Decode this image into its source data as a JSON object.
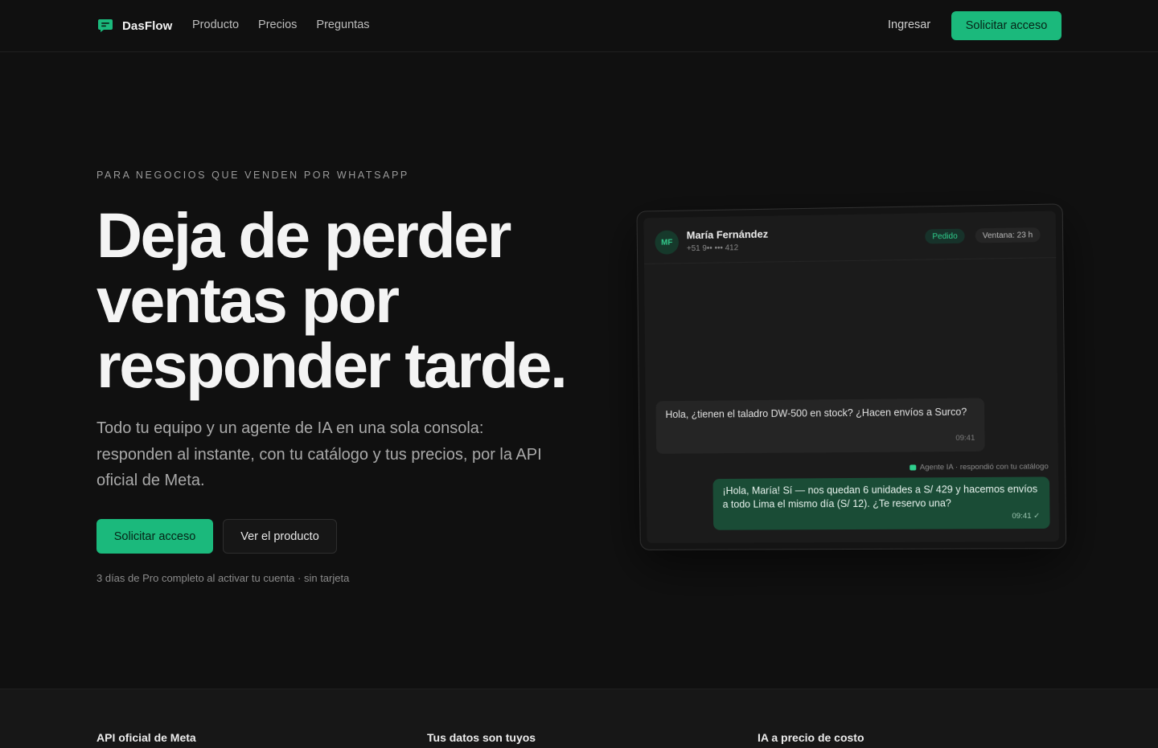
{
  "nav": {
    "brand": "DasFlow",
    "links": [
      "Producto",
      "Precios",
      "Preguntas"
    ],
    "login": "Ingresar",
    "cta": "Solicitar acceso"
  },
  "hero": {
    "eyebrow": "PARA NEGOCIOS QUE VENDEN POR WHATSAPP",
    "headline_lines": [
      "Deja de perder",
      "ventas por",
      "responder tarde."
    ],
    "subtext": "Todo tu equipo y un agente de IA en una sola consola: responden al instante, con tu catálogo y tus precios, por la API oficial de Meta.",
    "cta_primary": "Solicitar acceso",
    "cta_secondary": "Ver el producto",
    "note": "3 días de Pro completo al activar tu cuenta · sin tarjeta"
  },
  "chat": {
    "avatar_initials": "MF",
    "contact_name": "María Fernández",
    "contact_phone": "+51 9•• ••• 412",
    "badge_pedido": "Pedido",
    "badge_ventana": "Ventana: 23 h",
    "incoming": {
      "text": "Hola, ¿tienen el taladro DW-500 en stock? ¿Hacen envíos a Surco?",
      "time": "09:41"
    },
    "ai_label": "Agente IA · respondió con tu catálogo",
    "outgoing": {
      "text": "¡Hola, María! Sí — nos quedan 6 unidades a S/ 429 y hacemos envíos a todo Lima el mismo día (S/ 12). ¿Te reservo una?",
      "time": "09:41 ✓"
    }
  },
  "features": [
    "API oficial de Meta",
    "Tus datos son tuyos",
    "IA a precio de costo"
  ],
  "colors": {
    "accent": "#1bb97c",
    "background": "#101010",
    "outgoing_bubble": "#1a4c36"
  }
}
